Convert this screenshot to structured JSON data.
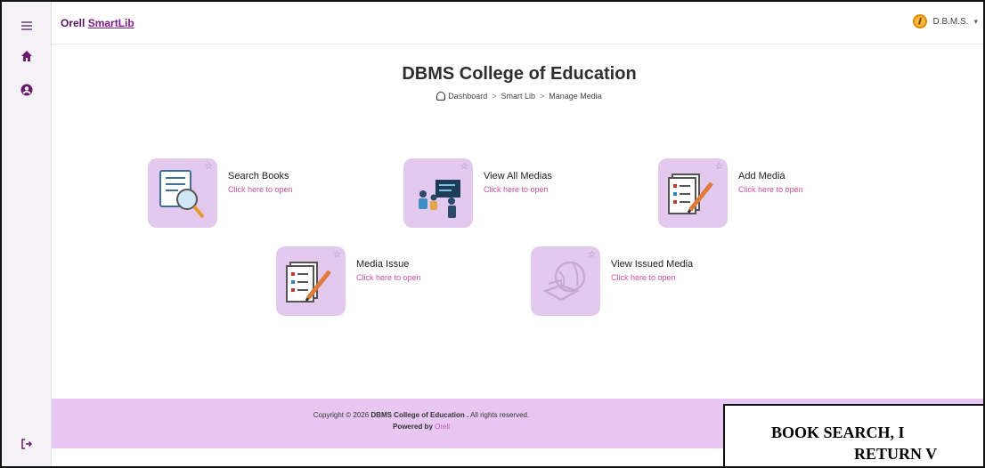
{
  "brand": {
    "prefix": "Orell ",
    "name": "SmartLib"
  },
  "user": {
    "name": "D.B.M.S.",
    "caret": "▾"
  },
  "page": {
    "title": "DBMS College of Education",
    "breadcrumb": [
      "Dashboard",
      "Smart Lib",
      "Manage Media"
    ],
    "breadcrumb_sep": ">"
  },
  "cards": [
    {
      "name": "Search Books",
      "link": "Click here to open",
      "icon": "search-book-icon"
    },
    {
      "name": "View All Medias",
      "link": "Click here to open",
      "icon": "presentation-icon"
    },
    {
      "name": "Add Media",
      "link": "Click here to open",
      "icon": "edit-list-icon"
    },
    {
      "name": "Media Issue",
      "link": "Click here to open",
      "icon": "edit-list-icon"
    },
    {
      "name": "View Issued Media",
      "link": "Click here to open",
      "icon": "globe-book-icon"
    }
  ],
  "footer": {
    "copyright_prefix": "Copyright © 2026 ",
    "org": "DBMS College of Education .",
    "rights": "  All rights reserved.",
    "powered_prefix": "Powered by ",
    "powered_name": "Orell"
  },
  "overlay": {
    "line1": "BOOK SEARCH, I",
    "line2": "RETURN V"
  },
  "colors": {
    "accent": "#6a1b6f",
    "tile": "#e3c9ee",
    "link": "#d0509a",
    "footer": "#e8c8f2"
  }
}
